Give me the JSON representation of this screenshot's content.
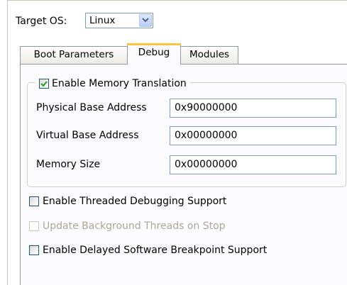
{
  "target_os": {
    "label": "Target OS:",
    "value": "Linux"
  },
  "tabs": [
    {
      "label": "Boot Parameters",
      "active": false
    },
    {
      "label": "Debug",
      "active": true
    },
    {
      "label": "Modules",
      "active": false
    }
  ],
  "memory_translation": {
    "label": "Enable Memory Translation",
    "checked": true,
    "fields": [
      {
        "label": "Physical Base Address",
        "value": "0x90000000"
      },
      {
        "label": "Virtual Base Address",
        "value": "0x00000000"
      },
      {
        "label": "Memory Size",
        "value": "0x00000000"
      }
    ]
  },
  "options": [
    {
      "label": "Enable Threaded Debugging Support",
      "checked": false,
      "enabled": true
    },
    {
      "label": "Update Background Threads on Stop",
      "checked": false,
      "enabled": false
    },
    {
      "label": "Enable Delayed Software Breakpoint Support",
      "checked": false,
      "enabled": true
    }
  ],
  "colors": {
    "checkmark": "#21a121",
    "accent_tab": "#ffc83c",
    "disabled_text": "#aca899"
  }
}
